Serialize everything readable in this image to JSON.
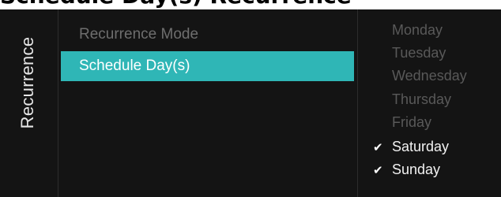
{
  "header_strip": {
    "text": "Schedule Day(s) Recurrence"
  },
  "sidebar": {
    "title": "Recurrence"
  },
  "menu": {
    "items": [
      {
        "label": "Recurrence Mode",
        "selected": false
      },
      {
        "label": "Schedule Day(s)",
        "selected": true
      }
    ]
  },
  "days": [
    {
      "label": "Monday",
      "checked": false
    },
    {
      "label": "Tuesday",
      "checked": false
    },
    {
      "label": "Wednesday",
      "checked": false
    },
    {
      "label": "Thursday",
      "checked": false
    },
    {
      "label": "Friday",
      "checked": false
    },
    {
      "label": "Saturday",
      "checked": true
    },
    {
      "label": "Sunday",
      "checked": true
    }
  ],
  "colors": {
    "background": "#141414",
    "highlight": "#2fb6b6",
    "dim_text": "#595959",
    "active_text": "#ffffff"
  },
  "icons": {
    "check": "check-icon"
  }
}
